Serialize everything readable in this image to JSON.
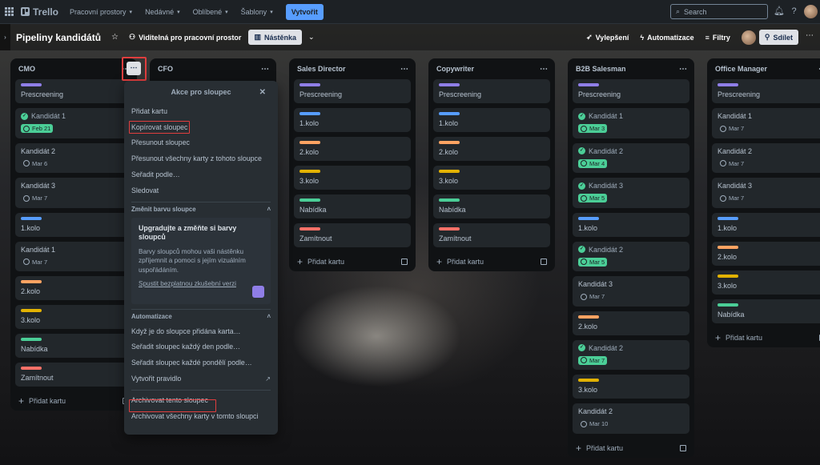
{
  "topbar": {
    "logo": "Trello",
    "nav": [
      "Pracovní prostory",
      "Nedávné",
      "Oblíbené",
      "Šablony"
    ],
    "create": "Vytvořit",
    "search_placeholder": "Search"
  },
  "boardbar": {
    "title": "Pipeliny kandidátů",
    "visibility": "Viditelná pro pracovní prostor",
    "view": "Nástěnka",
    "powerups": "Vylepšení",
    "automation": "Automatizace",
    "filters": "Filtry",
    "share": "Sdílet"
  },
  "lists": [
    {
      "title": "CMO",
      "cards": [
        {
          "label": "#8f7ee7",
          "title": "Prescreening"
        },
        {
          "title": "Kandidát 1",
          "done": true,
          "date": "Feb 21",
          "date_style": "green"
        },
        {
          "title": "Kandidát 2",
          "date": "Mar 6"
        },
        {
          "title": "Kandidát 3",
          "date": "Mar 7"
        },
        {
          "label": "#579dff",
          "title": "1.kolo"
        },
        {
          "title": "Kandidát 1",
          "date": "Mar 7"
        },
        {
          "label": "#fea362",
          "title": "2.kolo"
        },
        {
          "label": "#e2b203",
          "title": "3.kolo"
        },
        {
          "label": "#4bce97",
          "title": "Nabídka"
        },
        {
          "label": "#f87168",
          "title": "Zamítnout"
        }
      ],
      "add": "Přidat kartu"
    },
    {
      "title": "CFO",
      "cards": [],
      "add": ""
    },
    {
      "title": "Sales Director",
      "cards": [
        {
          "label": "#8f7ee7",
          "title": "Prescreening"
        },
        {
          "label": "#579dff",
          "title": "1.kolo"
        },
        {
          "label": "#fea362",
          "title": "2.kolo"
        },
        {
          "label": "#e2b203",
          "title": "3.kolo"
        },
        {
          "label": "#4bce97",
          "title": "Nabídka"
        },
        {
          "label": "#f87168",
          "title": "Zamítnout"
        }
      ],
      "add": "Přidat kartu"
    },
    {
      "title": "Copywriter",
      "cards": [
        {
          "label": "#8f7ee7",
          "title": "Prescreening"
        },
        {
          "label": "#579dff",
          "title": "1.kolo"
        },
        {
          "label": "#fea362",
          "title": "2.kolo"
        },
        {
          "label": "#e2b203",
          "title": "3.kolo"
        },
        {
          "label": "#4bce97",
          "title": "Nabídka"
        },
        {
          "label": "#f87168",
          "title": "Zamítnout"
        }
      ],
      "add": "Přidat kartu"
    },
    {
      "title": "B2B Salesman",
      "cards": [
        {
          "label": "#8f7ee7",
          "title": "Prescreening"
        },
        {
          "title": "Kandidát 1",
          "done": true,
          "date": "Mar 3",
          "date_style": "green"
        },
        {
          "title": "Kandidát 2",
          "done": true,
          "date": "Mar 4",
          "date_style": "green"
        },
        {
          "title": "Kandidát 3",
          "done": true,
          "date": "Mar 5",
          "date_style": "green"
        },
        {
          "label": "#579dff",
          "title": "1.kolo"
        },
        {
          "title": "Kandidát 2",
          "done": true,
          "date": "Mar 5",
          "date_style": "green"
        },
        {
          "title": "Kandidát 3",
          "date": "Mar 7"
        },
        {
          "label": "#fea362",
          "title": "2.kolo"
        },
        {
          "title": "Kandidát 2",
          "done": true,
          "date": "Mar 7",
          "date_style": "green"
        },
        {
          "label": "#e2b203",
          "title": "3.kolo"
        },
        {
          "title": "Kandidát 2",
          "date": "Mar 10"
        }
      ],
      "add": "Přidat kartu"
    },
    {
      "title": "Office Manager",
      "cards": [
        {
          "label": "#8f7ee7",
          "title": "Prescreening"
        },
        {
          "title": "Kandidát 1",
          "date": "Mar 7"
        },
        {
          "title": "Kandidát 2",
          "date": "Mar 7"
        },
        {
          "title": "Kandidát 3",
          "date": "Mar 7"
        },
        {
          "label": "#579dff",
          "title": "1.kolo"
        },
        {
          "label": "#fea362",
          "title": "2.kolo"
        },
        {
          "label": "#e2b203",
          "title": "3.kolo"
        },
        {
          "label": "#4bce97",
          "title": "Nabídka"
        }
      ],
      "add": "Přidat kartu"
    }
  ],
  "popover": {
    "title": "Akce pro sloupec",
    "items": [
      "Přidat kartu",
      "Kopírovat sloupec",
      "Přesunout sloupec",
      "Přesunout všechny karty z tohoto sloupce",
      "Seřadit podle…",
      "Sledovat"
    ],
    "color_section": "Změnit barvu sloupce",
    "upgrade_title": "Upgradujte a změňte si barvy sloupců",
    "upgrade_text": "Barvy sloupců mohou vaši nástěnku zpříjemnit a pomoci s jejím vizuálním uspořádáním.",
    "upgrade_link": "Spustit bezplatnou zkušební verzi",
    "automation_section": "Automatizace",
    "automation_items": [
      "Když je do sloupce přidána karta…",
      "Seřadit sloupec každý den podle…",
      "Seřadit sloupec každé pondělí podle…",
      "Vytvořit pravidlo"
    ],
    "archive_items": [
      "Archivovat tento sloupec",
      "Archivovat všechny karty v tomto sloupci"
    ]
  },
  "colors": {
    "highlight": "#e03e3e",
    "create_button": "#579dff",
    "list_bg": "#101214",
    "card_bg": "#22272b"
  }
}
